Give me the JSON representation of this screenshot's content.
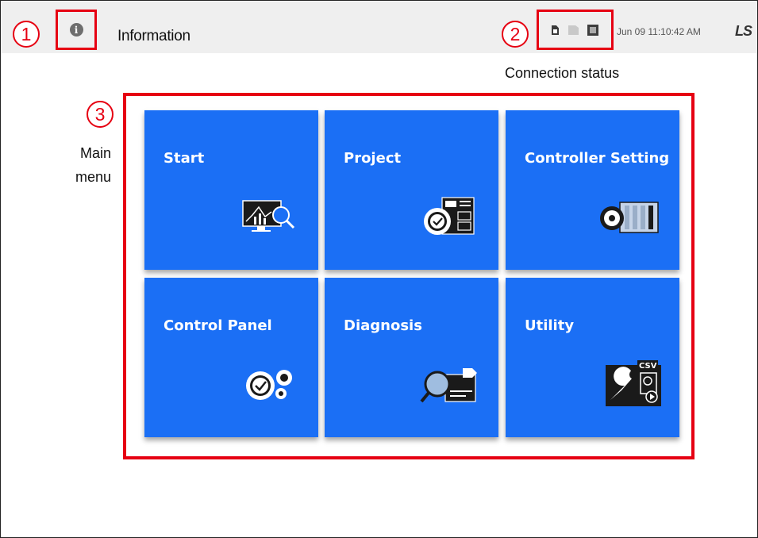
{
  "header": {
    "title": "Information",
    "datetime": "Jun 09 11:10:42 AM",
    "logo": "LS",
    "info_icon": "info-circle-icon",
    "status_icons": [
      "sd-card-icon",
      "sd-card-inactive-icon",
      "network-port-icon"
    ]
  },
  "annotations": {
    "callout_1": "1",
    "callout_2": "2",
    "callout_3": "3",
    "connection_status": "Connection status",
    "main_menu_line1": "Main",
    "main_menu_line2": "menu"
  },
  "menu": {
    "tiles": [
      {
        "label": "Start",
        "icon": "monitor-chart-magnifier-icon"
      },
      {
        "label": "Project",
        "icon": "gear-check-document-icon"
      },
      {
        "label": "Controller Setting",
        "icon": "gear-plc-rack-icon"
      },
      {
        "label": "Control Panel",
        "icon": "gears-check-icon"
      },
      {
        "label": "Diagnosis",
        "icon": "magnifier-module-icon"
      },
      {
        "label": "Utility",
        "icon": "wrench-csv-icon"
      }
    ]
  },
  "colors": {
    "tile_blue": "#1b6ff5",
    "highlight_red": "#e60012",
    "header_bg": "#efefef"
  }
}
